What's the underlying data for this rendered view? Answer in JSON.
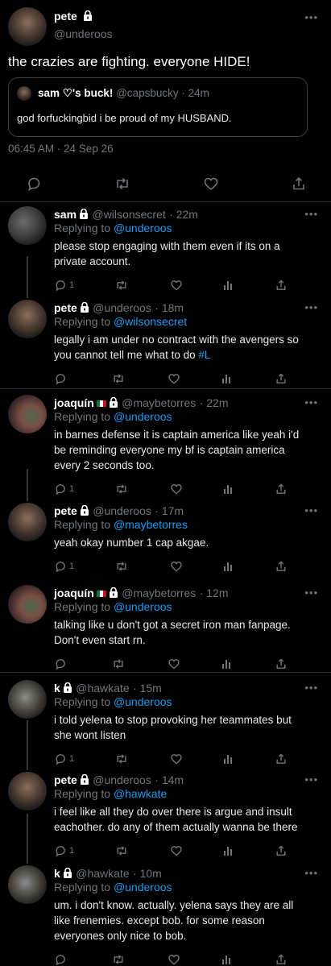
{
  "main_tweet": {
    "name": "pete",
    "handle": "@underoos",
    "text": "the crazies are fighting. everyone HIDE!",
    "quote": {
      "name": "sam ♡'s buck!",
      "handle": "@capsbucky",
      "time": "· 24m",
      "text": "god forfuckingbid i be proud of my HUSBAND."
    },
    "timestamp": "06:45 AM · 24 Sep 26"
  },
  "replies": [
    {
      "name": "sam",
      "handle": "@wilsonsecret",
      "time": "· 22m",
      "reply_label": "Replying to",
      "reply_to": "@underoos",
      "lines": [
        "please stop engaging with them even if its on a",
        "private account."
      ],
      "reply_count": "1",
      "avatar": "a2"
    },
    {
      "name": "pete",
      "handle": "@underoos",
      "time": "· 18m",
      "reply_label": "Replying to",
      "reply_to": "@wilsonsecret",
      "lines": [
        "legally i am under no contract with the avengers so",
        "you cannot tell me what to do"
      ],
      "hashtag": "#L",
      "reply_count": "",
      "avatar": "a1"
    },
    {
      "name": "joaquín",
      "handle": "@maybetorres",
      "time": "· 22m",
      "reply_label": "Replying to",
      "reply_to": "@underoos",
      "lines": [
        "in barnes defense it is captain america like yeah i'd",
        "be reminding everyone my bf is captain america",
        "every 2 seconds too."
      ],
      "reply_count": "1",
      "avatar": "a3",
      "flag": true
    },
    {
      "name": "pete",
      "handle": "@underoos",
      "time": "· 17m",
      "reply_label": "Replying to",
      "reply_to": "@maybetorres",
      "lines": [
        "yeah okay number 1 cap akgae."
      ],
      "reply_count": "1",
      "avatar": "a1"
    },
    {
      "name": "joaquín",
      "handle": "@maybetorres",
      "time": "· 12m",
      "reply_label": "Replying to",
      "reply_to": "@underoos",
      "lines": [
        "talking like u don't got a secret iron man fanpage.",
        "Don't even start rn."
      ],
      "reply_count": "",
      "avatar": "a3",
      "flag": true
    },
    {
      "name": "k",
      "handle": "@hawkate",
      "time": "· 15m",
      "reply_label": "Replying to",
      "reply_to": "@underoos",
      "lines": [
        "i told yelena to stop provoking her teammates but",
        "she wont listen"
      ],
      "reply_count": "1",
      "avatar": "a4"
    },
    {
      "name": "pete",
      "handle": "@underoos",
      "time": "· 14m",
      "reply_label": "Replying to",
      "reply_to": "@hawkate",
      "lines": [
        "i feel like all they do over there is argue and insult",
        "eachother. do any of them actually wanna be there"
      ],
      "reply_count": "1",
      "avatar": "a1"
    },
    {
      "name": "k",
      "handle": "@hawkate",
      "time": "· 10m",
      "reply_label": "Replying to",
      "reply_to": "@underoos",
      "lines": [
        "um. i don't know. actually. yelena says they are all",
        "like frenemies. except bob. for some reason",
        "everyones only nice to bob."
      ],
      "reply_count": "",
      "avatar": "a4"
    }
  ],
  "icons": {
    "lock": "lock-icon",
    "more": "more-icon",
    "reply": "reply-icon",
    "retweet": "retweet-icon",
    "like": "heart-icon",
    "views": "views-icon",
    "share": "share-icon"
  },
  "colors": {
    "background": "#000000",
    "link": "#1d9bf0",
    "muted": "#71767b",
    "text": "#e7e9ea"
  }
}
